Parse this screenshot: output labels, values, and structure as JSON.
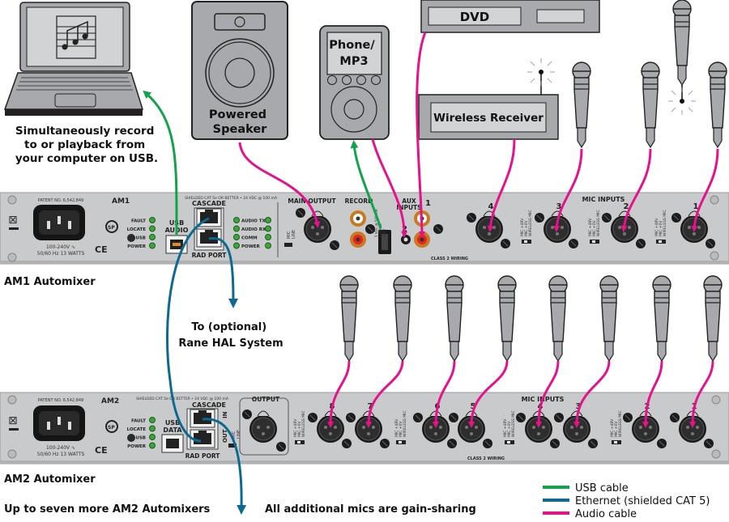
{
  "colors": {
    "usb": "#12a34b",
    "ethernet": "#0c6a92",
    "audio": "#e5128c",
    "panel": "#c9cacc",
    "device": "#a7a9ac",
    "led": "#3aa63a"
  },
  "devices": {
    "laptop_caption": [
      "Simultaneously record",
      "to or playback from",
      "your computer on USB."
    ],
    "speaker_label": [
      "Powered",
      "Speaker"
    ],
    "phone_label": [
      "Phone/",
      "MP3"
    ],
    "dvd_label": "DVD",
    "wireless_label": "Wireless Receiver"
  },
  "am1": {
    "caption": "AM1 Automixer",
    "model": "AM1",
    "patent": "PATENT NO. 6,542,849",
    "power_rating": [
      "100-240V ∿",
      "50/60 Hz  13 WATTS"
    ],
    "status_leds": [
      "FAULT",
      "LOCATE",
      "USB",
      "POWER"
    ],
    "usb_label": [
      "USB",
      "AUDIO"
    ],
    "cascade_note": "SHIELDED CAT 5e OR BETTER • 24 VDC @ 100 mA",
    "cascade_label": "CASCADE",
    "rad_port_label": "RAD PORT",
    "cascade_leds": [
      "AUDIO TX",
      "AUDIO RX",
      "COMM",
      "POWER"
    ],
    "main_output_label": "MAIN OUTPUT",
    "mic_line_switch": [
      "MIC",
      "LINE"
    ],
    "record_label": "RECORD",
    "usb_charge_label": [
      "5 VDC @ 500 mA",
      "CHARGE",
      "ONLY"
    ],
    "aux_inputs_label": [
      "AUX",
      "INPUTS"
    ],
    "aux_numbers": [
      "1",
      "2"
    ],
    "class2": "CLASS 2 WIRING",
    "mic_inputs_label": "MIC INPUTS",
    "mic_channels": [
      "4",
      "3",
      "2",
      "1"
    ],
    "mic_switch_labels": [
      "MIC +48V",
      "MIC +0V",
      "WIRELESS MIC"
    ]
  },
  "am2": {
    "caption": "AM2 Automixer",
    "model": "AM2",
    "patent": "PATENT NO. 6,542,849",
    "power_rating": [
      "100-240V ∿",
      "50/60 Hz  13 WATTS"
    ],
    "status_leds": [
      "FAULT",
      "LOCATE",
      "USB",
      "POWER"
    ],
    "usb_label": [
      "USB",
      "DATA"
    ],
    "cascade_note": "SHIELDED CAT 5e OR BETTER • 24 VDC @ 100 mA",
    "cascade_label": "CASCADE",
    "rad_port_label": "RAD PORT",
    "in_out": [
      "IN",
      "OUT"
    ],
    "mic_line_switch": [
      "MIC",
      "LINE"
    ],
    "output_label": "OUTPUT",
    "class2": "CLASS 2 WIRING",
    "mic_inputs_label": "MIC INPUTS",
    "mic_channels": [
      "8",
      "7",
      "6",
      "5",
      "4",
      "3",
      "2",
      "1"
    ],
    "mic_switch_labels": [
      "MIC +48V",
      "MIC +0V",
      "WIRELESS MIC"
    ]
  },
  "annotations": {
    "hal": [
      "To (optional)",
      "Rane HAL System"
    ],
    "more_am2": "Up to seven more AM2 Automixers",
    "gain_sharing": "All additional mics are gain-sharing"
  },
  "legend": [
    {
      "label": "USB cable",
      "color": "#12a34b"
    },
    {
      "label": "Ethernet (shielded CAT 5)",
      "color": "#0c6a92"
    },
    {
      "label": "Audio cable",
      "color": "#e5128c"
    }
  ]
}
